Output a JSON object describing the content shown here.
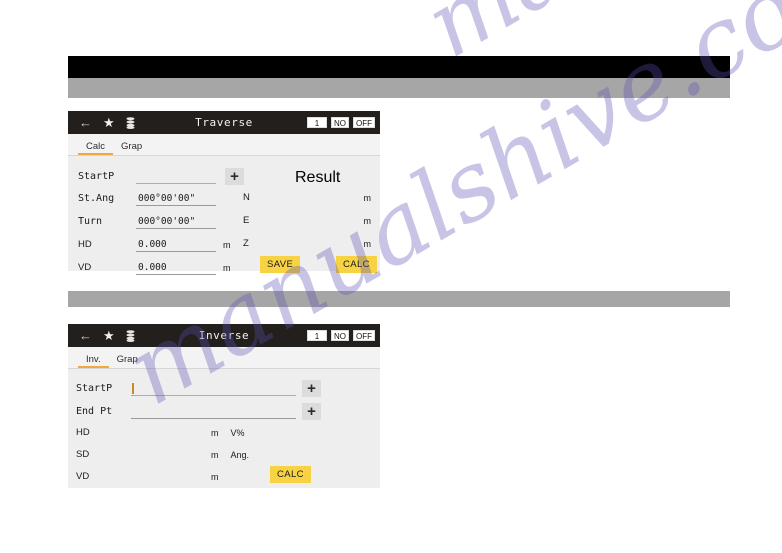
{
  "page": {
    "watermark": "manualshive.com",
    "banner_black": "",
    "banner_gray_top": "",
    "banner_gray_mid": ""
  },
  "traverse": {
    "titlebar": {
      "back_icon": "back-arrow-icon",
      "star_icon": "star-icon",
      "stack_icon": "stack-icon",
      "title": "Traverse",
      "badges": [
        "1",
        "NO",
        "OFF"
      ]
    },
    "tabs": [
      {
        "label": "Calc",
        "active": true
      },
      {
        "label": "Grap",
        "active": false
      }
    ],
    "fields": [
      {
        "label": "StartP",
        "value": "",
        "unit": "",
        "focused": true,
        "has_plus": true
      },
      {
        "label": "St.Ang",
        "value": "000°00'00\"",
        "unit": "",
        "focused": false,
        "has_plus": false
      },
      {
        "label": "Turn",
        "value": "000°00'00\"",
        "unit": "",
        "focused": false,
        "has_plus": false
      },
      {
        "label": "HD",
        "value": "0.000",
        "unit": "m",
        "focused": false,
        "has_plus": false
      },
      {
        "label": "VD",
        "value": "0.000",
        "unit": "m",
        "focused": false,
        "has_plus": false
      }
    ],
    "plus_label": "+",
    "result": {
      "header": "Result",
      "rows": [
        {
          "label": "N",
          "value": "",
          "unit": "m"
        },
        {
          "label": "E",
          "value": "",
          "unit": "m"
        },
        {
          "label": "Z",
          "value": "",
          "unit": "m"
        }
      ]
    },
    "buttons": {
      "save": "SAVE",
      "calc": "CALC"
    }
  },
  "inverse": {
    "titlebar": {
      "back_icon": "back-arrow-icon",
      "star_icon": "star-icon",
      "stack_icon": "stack-icon",
      "title": "Inverse",
      "badges": [
        "1",
        "NO",
        "OFF"
      ]
    },
    "tabs": [
      {
        "label": "Inv.",
        "active": true
      },
      {
        "label": "Grap",
        "active": false
      }
    ],
    "point_fields": [
      {
        "label": "StartP",
        "value": "",
        "focused": true
      },
      {
        "label": "End Pt",
        "value": "",
        "focused": false
      }
    ],
    "plus_label": "+",
    "value_rows": [
      {
        "label": "HD",
        "value": "",
        "unit": "m",
        "extra": "V%"
      },
      {
        "label": "SD",
        "value": "",
        "unit": "m",
        "extra": "Ang."
      },
      {
        "label": "VD",
        "value": "",
        "unit": "m",
        "extra": ""
      }
    ],
    "buttons": {
      "calc": "CALC"
    }
  },
  "colors": {
    "accent_orange": "#f0a93b",
    "button_yellow": "#f7d344",
    "titlebar_dark": "#231f1c",
    "panel_bg": "#eeeeee",
    "watermark": "#5b50b5"
  }
}
